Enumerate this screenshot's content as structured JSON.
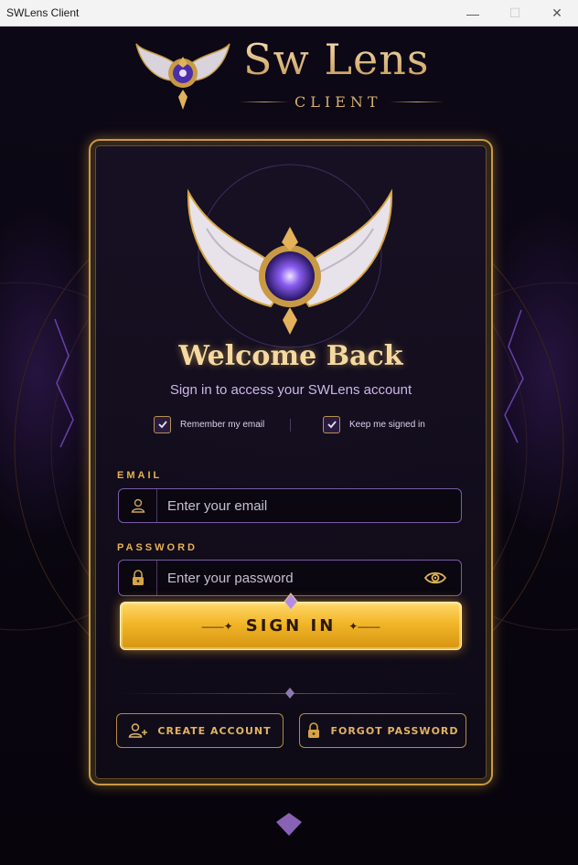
{
  "window": {
    "title": "SWLens Client",
    "minimize": "—",
    "maximize": "☐",
    "close": "✕"
  },
  "brand": {
    "name": "Sw Lens",
    "sub": "CLIENT"
  },
  "login": {
    "heading": "Welcome Back",
    "subtitle": "Sign in to access your SWLens account",
    "remember_email": {
      "label": "Remember my email",
      "checked": true
    },
    "keep_signed_in": {
      "label": "Keep me signed in",
      "checked": true
    },
    "email": {
      "label": "EMAIL",
      "placeholder": "Enter your email",
      "value": ""
    },
    "password": {
      "label": "PASSWORD",
      "placeholder": "Enter your password",
      "value": ""
    },
    "sign_in": "SIGN IN",
    "create_account": "CREATE ACCOUNT",
    "forgot_password": "FORGOT PASSWORD"
  },
  "colors": {
    "gold": "#e6b24f",
    "purple_border": "#7a5aa6",
    "button_gold": "#f2b628",
    "background": "#0b0712"
  },
  "icons": [
    "user-icon",
    "lock-icon",
    "eye-icon",
    "add-user-icon",
    "check-icon"
  ]
}
